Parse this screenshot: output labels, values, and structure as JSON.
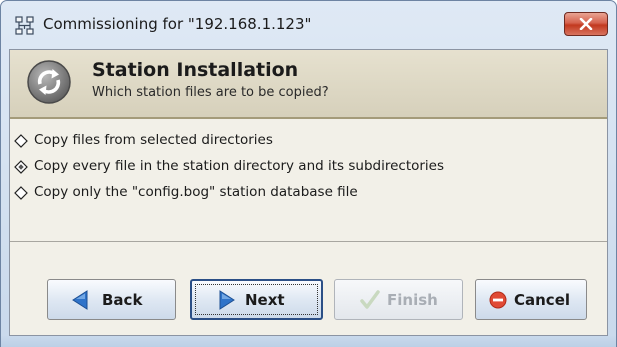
{
  "window": {
    "title": "Commissioning for \"192.168.1.123\"",
    "close_icon": "close-icon",
    "app_icon": "network-grid-icon"
  },
  "header": {
    "title": "Station Installation",
    "subtitle": "Which station files are to be copied?",
    "icon": "refresh-arrows-icon"
  },
  "options": [
    {
      "label": "Copy files from selected directories",
      "selected": false
    },
    {
      "label": "Copy every file in the station directory and its subdirectories",
      "selected": true
    },
    {
      "label": "Copy only the \"config.bog\" station database file",
      "selected": false
    }
  ],
  "buttons": {
    "back": {
      "label": "Back",
      "icon": "left-arrow-icon",
      "enabled": true
    },
    "next": {
      "label": "Next",
      "icon": "right-arrow-icon",
      "enabled": true,
      "focused": true
    },
    "finish": {
      "label": "Finish",
      "icon": "checkmark-icon",
      "enabled": false
    },
    "cancel": {
      "label": "Cancel",
      "icon": "cancel-icon",
      "enabled": true
    }
  },
  "colors": {
    "accent": "#2f73c9",
    "cancel_red": "#e04a35",
    "header_bg": "#dcd6c2",
    "content_bg": "#f2f0e8"
  }
}
